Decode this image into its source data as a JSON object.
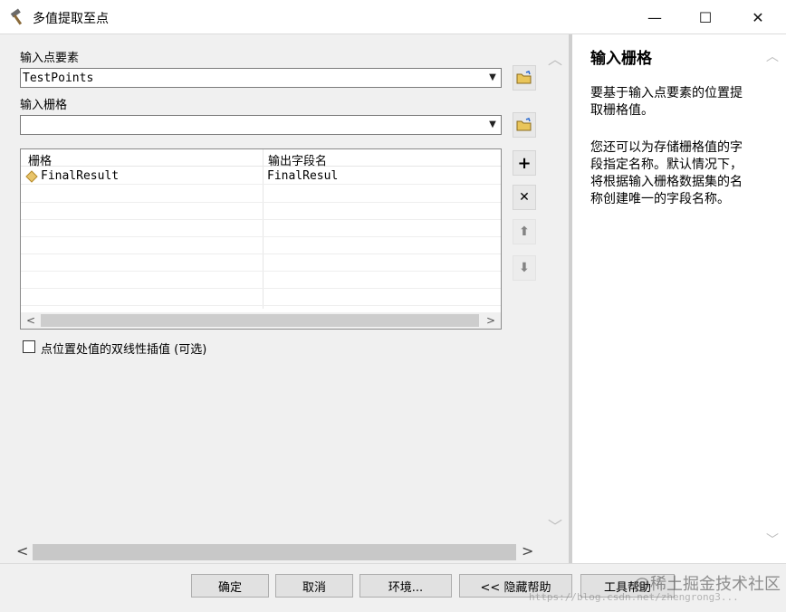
{
  "window": {
    "title": "多值提取至点",
    "minimize_glyph": "—",
    "maximize_glyph": "☐",
    "close_glyph": "✕"
  },
  "form": {
    "input_points_label": "输入点要素",
    "input_points_value": "TestPoints",
    "input_raster_label": "输入栅格",
    "input_raster_value": "",
    "grid_columns": [
      "栅格",
      "输出字段名"
    ],
    "grid_rows": [
      {
        "raster": "FinalResult",
        "field": "FinalResul"
      }
    ],
    "bilinear_label": "点位置处值的双线性插值 (可选)",
    "bilinear_checked": false
  },
  "help": {
    "title": "输入栅格",
    "paragraphs": [
      "要基于输入点要素的位置提取栅格值。",
      "您还可以为存储栅格值的字段指定名称。默认情况下，将根据输入栅格数据集的名称创建唯一的字段名称。"
    ]
  },
  "buttons": {
    "ok": "确定",
    "cancel": "取消",
    "environments": "环境...",
    "hide_help": "<< 隐藏帮助",
    "tool_help": "工具帮助"
  },
  "watermark": {
    "text": "@稀土掘金技术社区",
    "url": "https://blog.csdn.net/zhengrong3..."
  },
  "colors": {
    "title_bar": "#ffffff",
    "background": "#f0f0f0",
    "raster_icon": "#e8c46a"
  }
}
